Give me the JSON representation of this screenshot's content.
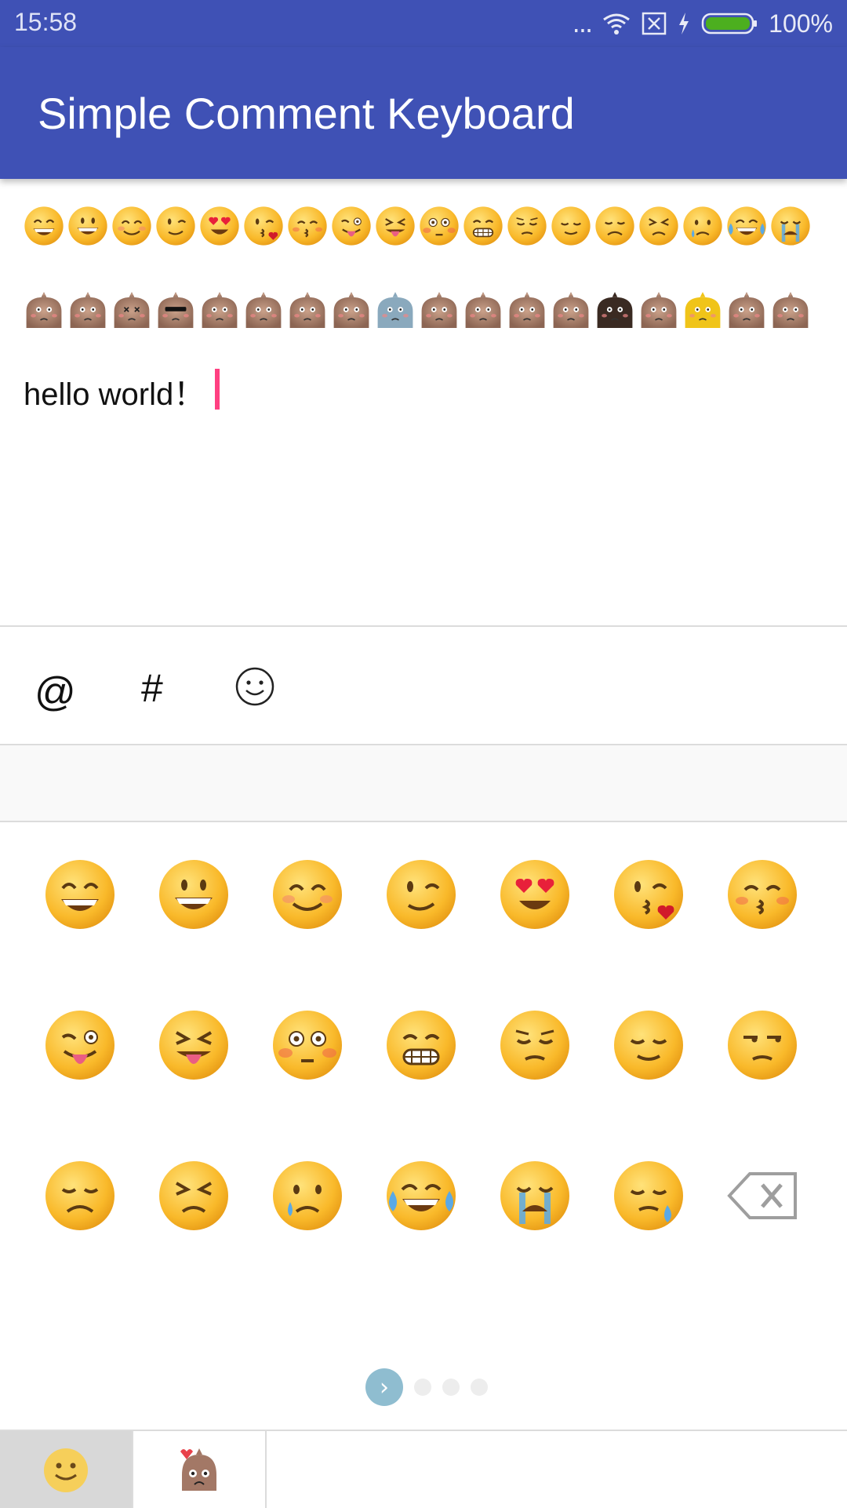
{
  "status_bar": {
    "time": "15:58",
    "more": "...",
    "battery_percent": "100%"
  },
  "app_bar": {
    "title": "Simple Comment Keyboard"
  },
  "editor": {
    "text": "hello world！"
  },
  "toolbar": {
    "at_label": "@",
    "hash_label": "#",
    "emoji_icon": "smiley-icon"
  },
  "emoji_preview": {
    "yellow_row": [
      "grin",
      "smiley",
      "blush",
      "wink",
      "heart-eyes",
      "kiss-heart",
      "kiss-closed",
      "tongue-wink",
      "tongue-squint",
      "flushed",
      "grimace",
      "pensive",
      "relieved",
      "disappointed",
      "persevere",
      "cry",
      "joy",
      "sob"
    ],
    "monkey_row": [
      "angry",
      "neutral",
      "dizzy",
      "cool",
      "crying",
      "surprised",
      "confused",
      "dizzy-eyes",
      "frozen",
      "grin",
      "sweat",
      "smirk",
      "grimace",
      "dark",
      "question",
      "star",
      "sigh",
      "dead"
    ]
  },
  "keyboard": {
    "page_indicator": {
      "current": 1,
      "total": 4
    },
    "rows": [
      [
        "grin",
        "smiley",
        "blush",
        "wink",
        "heart-eyes",
        "kiss-heart",
        "kiss-closed"
      ],
      [
        "tongue-wink",
        "tongue-squint",
        "flushed",
        "grimace",
        "pensive",
        "relieved",
        "unamused"
      ],
      [
        "disappointed",
        "persevere",
        "cry",
        "joy",
        "sob",
        "sleepy",
        "backspace"
      ]
    ]
  },
  "tabs": [
    {
      "icon": "yellow-smiley-tab-icon",
      "selected": true
    },
    {
      "icon": "monkey-tab-icon",
      "selected": false
    }
  ],
  "colors": {
    "primary": "#3f51b5",
    "accent": "#ff4081",
    "emoji": "#f6b428"
  }
}
